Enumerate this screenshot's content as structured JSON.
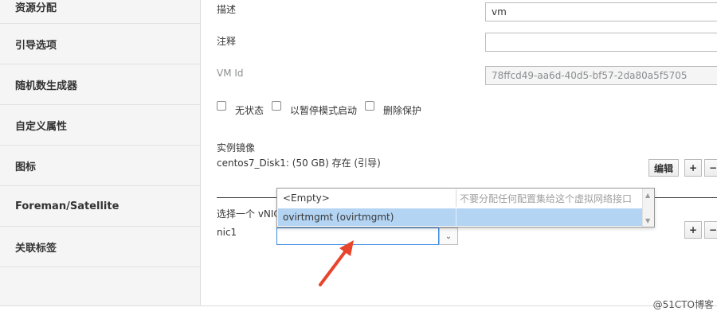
{
  "sidebar": {
    "items": [
      {
        "label": "资源分配"
      },
      {
        "label": "引导选项"
      },
      {
        "label": "随机数生成器"
      },
      {
        "label": "自定义属性"
      },
      {
        "label": "图标"
      },
      {
        "label": "Foreman/Satellite"
      },
      {
        "label": "关联标签"
      }
    ]
  },
  "form": {
    "description_label": "描述",
    "description_value": "vm",
    "comment_label": "注释",
    "comment_value": "",
    "vmid_label": "VM Id",
    "vmid_value": "78ffcd49-aa6d-40d5-bf57-2da80a5f5705",
    "checkboxes": [
      {
        "label": "无状态",
        "checked": false
      },
      {
        "label": "以暂停模式启动",
        "checked": false
      },
      {
        "label": "删除保护",
        "checked": false
      }
    ],
    "instance_image_label": "实例镜像",
    "instance_image_value": "centos7_Disk1: (50 GB) 存在 (引导)",
    "edit_button": "编辑",
    "plus": "+",
    "minus": "−",
    "vnic_label": "选择一个 vNIC",
    "nic_name": "nic1"
  },
  "dropdown": {
    "rows": [
      {
        "name": "<Empty>",
        "desc": "不要分配任何配置集给这个虚拟网络接口"
      },
      {
        "name": "ovirtmgmt (ovirtmgmt)",
        "desc": ""
      }
    ],
    "selected_index": 1
  },
  "watermark": "@51CTO博客",
  "colors": {
    "accent": "#3d8be0",
    "selected_row": "#b3d4f3",
    "arrow": "#e8452c"
  }
}
